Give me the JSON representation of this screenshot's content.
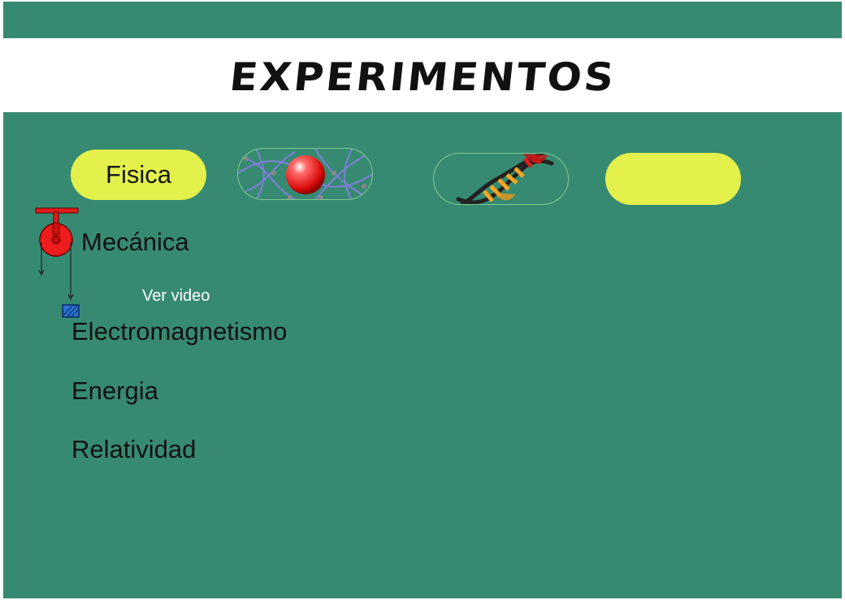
{
  "header": {
    "title": "EXPERIMENTOS"
  },
  "tabs": [
    {
      "label": "Fisica",
      "icon": "pendulum-icon"
    },
    {
      "label": "",
      "icon": "atom-icon"
    },
    {
      "label": "",
      "icon": "dna-icon"
    },
    {
      "label": "",
      "icon": ""
    }
  ],
  "topics": [
    {
      "label": "Mecánica",
      "icon": "pulley-icon",
      "action": "Ver video"
    },
    {
      "label": "Electromagnetismo"
    },
    {
      "label": "Energia"
    },
    {
      "label": "Relatividad"
    }
  ],
  "colors": {
    "background": "#378a72",
    "header": "#ffffff",
    "accent": "#e4f04c",
    "tab_border": "#7fc98e"
  }
}
